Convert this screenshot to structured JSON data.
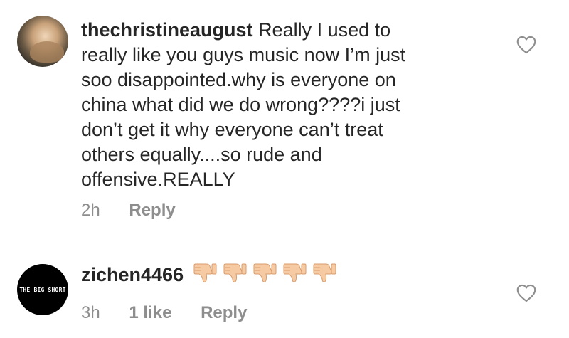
{
  "comments": [
    {
      "username": "thechristineaugust",
      "text": "Really I used to\nreally like you guys music now I’m just\nsoo disappointed.why is everyone on\nchina what did we do wrong????i just\ndon’t get it why everyone can’t treat\nothers equally....so rude and\noffensive.REALLY",
      "time": "2h",
      "reply_label": "Reply",
      "avatar_icon": "profile-photo"
    },
    {
      "username": "zichen4466",
      "emoji": [
        "thumbs-down-icon",
        "thumbs-down-icon",
        "thumbs-down-icon",
        "thumbs-down-icon",
        "thumbs-down-icon"
      ],
      "time": "3h",
      "likes": "1 like",
      "reply_label": "Reply",
      "avatar_text": "THE BIG SHORT"
    }
  ],
  "icons": {
    "like": "heart-outline-icon"
  },
  "colors": {
    "text": "#262626",
    "meta": "#8e8e8e",
    "emoji_skin": "#f6cba3"
  }
}
